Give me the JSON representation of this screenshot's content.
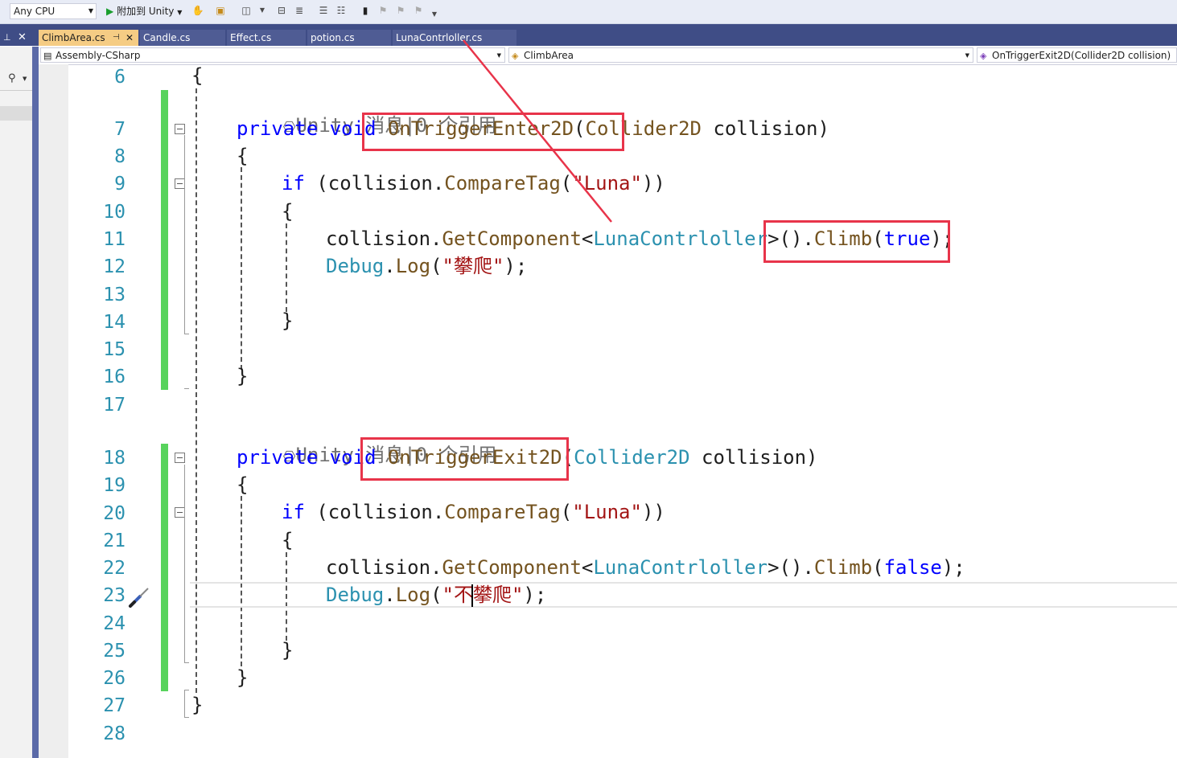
{
  "toolbar": {
    "platform": "Any CPU",
    "run_label": "附加到 Unity"
  },
  "tabs": [
    {
      "label": "ClimbArea.cs",
      "active": true
    },
    {
      "label": "Candle.cs",
      "active": false
    },
    {
      "label": "Effect.cs",
      "active": false
    },
    {
      "label": "potion.cs",
      "active": false
    },
    {
      "label": "LunaContrloller.cs",
      "active": false
    }
  ],
  "navbar": {
    "project": "Assembly-CSharp",
    "class": "ClimbArea",
    "member": "OnTriggerExit2D(Collider2D collision)"
  },
  "line_numbers": [
    "6",
    "7",
    "8",
    "9",
    "10",
    "11",
    "12",
    "13",
    "14",
    "15",
    "16",
    "17",
    "18",
    "19",
    "20",
    "21",
    "22",
    "23",
    "24",
    "25",
    "26",
    "27",
    "28"
  ],
  "codelens": {
    "first": "Unity 消息|0 个引用",
    "second": "Unity 消息|0 个引用"
  },
  "code": {
    "l6": "{",
    "l7_kw1": "private",
    "l7_kw2": "void",
    "l7_fn": "OnTriggerEnter2D",
    "l7_p1": "(",
    "l7_ty": "Collider2D",
    "l7_rest": " collision)",
    "l8": "{",
    "l9_kw": "if",
    "l9_a": " (collision.",
    "l9_fn": "CompareTag",
    "l9_b": "(",
    "l9_str": "\"Luna\"",
    "l9_c": "))",
    "l10": "{",
    "l11_a": "collision.",
    "l11_fn": "GetComponent",
    "l11_b": "<",
    "l11_ty": "LunaContrloller",
    "l11_c": ">().",
    "l11_fn2": "Climb",
    "l11_d": "(",
    "l11_kw": "true",
    "l11_e": ");",
    "l12_ty": "Debug",
    "l12_a": ".",
    "l12_fn": "Log",
    "l12_b": "(",
    "l12_str": "\"攀爬\"",
    "l12_c": ");",
    "l14": "}",
    "l16": "}",
    "l18_kw1": "private",
    "l18_kw2": "void",
    "l18_fn": "OnTriggerExit2D",
    "l18_p1": "(",
    "l18_ty": "Collider2D",
    "l18_rest": " collision)",
    "l19": "{",
    "l20_kw": "if",
    "l20_a": " (collision.",
    "l20_fn": "CompareTag",
    "l20_b": "(",
    "l20_str": "\"Luna\"",
    "l20_c": "))",
    "l21": "{",
    "l22_a": "collision.",
    "l22_fn": "GetComponent",
    "l22_b": "<",
    "l22_ty": "LunaContrloller",
    "l22_c": ">().",
    "l22_fn2": "Climb",
    "l22_d": "(",
    "l22_kw": "false",
    "l22_e": ");",
    "l23_ty": "Debug",
    "l23_a": ".",
    "l23_fn": "Log",
    "l23_b": "(",
    "l23_str": "\"不攀爬\"",
    "l23_c": ");",
    "l25": "}",
    "l26": "}",
    "l27": "}"
  },
  "colors": {
    "keyword": "#0000ff",
    "type": "#2b91af",
    "method": "#74531f",
    "string": "#a31515",
    "annotation": "#e8344a",
    "change_bar": "#57d35c"
  }
}
